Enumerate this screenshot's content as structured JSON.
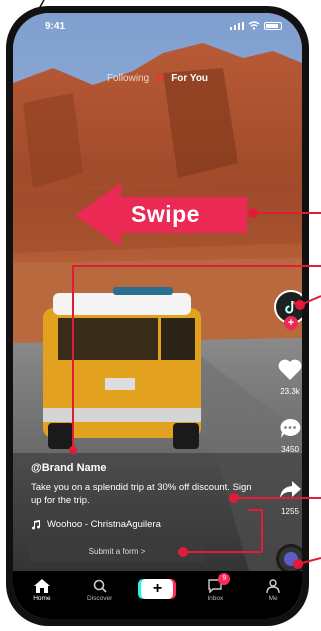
{
  "status_bar": {
    "time": "9:41"
  },
  "feed_tabs": {
    "following": "Following",
    "for_you": "For You"
  },
  "swipe_label": "Swipe",
  "actions": {
    "likes": "23.3k",
    "comments": "3450",
    "shares": "1255"
  },
  "post": {
    "brand": "@Brand Name",
    "description": "Take you on a splendid trip at 30% off discount. Sign up for the trip.",
    "music": "Woohoo - ChristnaAguilera",
    "cta": "Submit a form >"
  },
  "nav": {
    "home": "Home",
    "discover": "Discover",
    "inbox": "Inbox",
    "inbox_badge": "9",
    "me": "Me"
  },
  "colors": {
    "accent": "#ea2a55",
    "cyan": "#25f4ee",
    "callout_line": "#e31b3b",
    "phone_frame": "#111111"
  }
}
